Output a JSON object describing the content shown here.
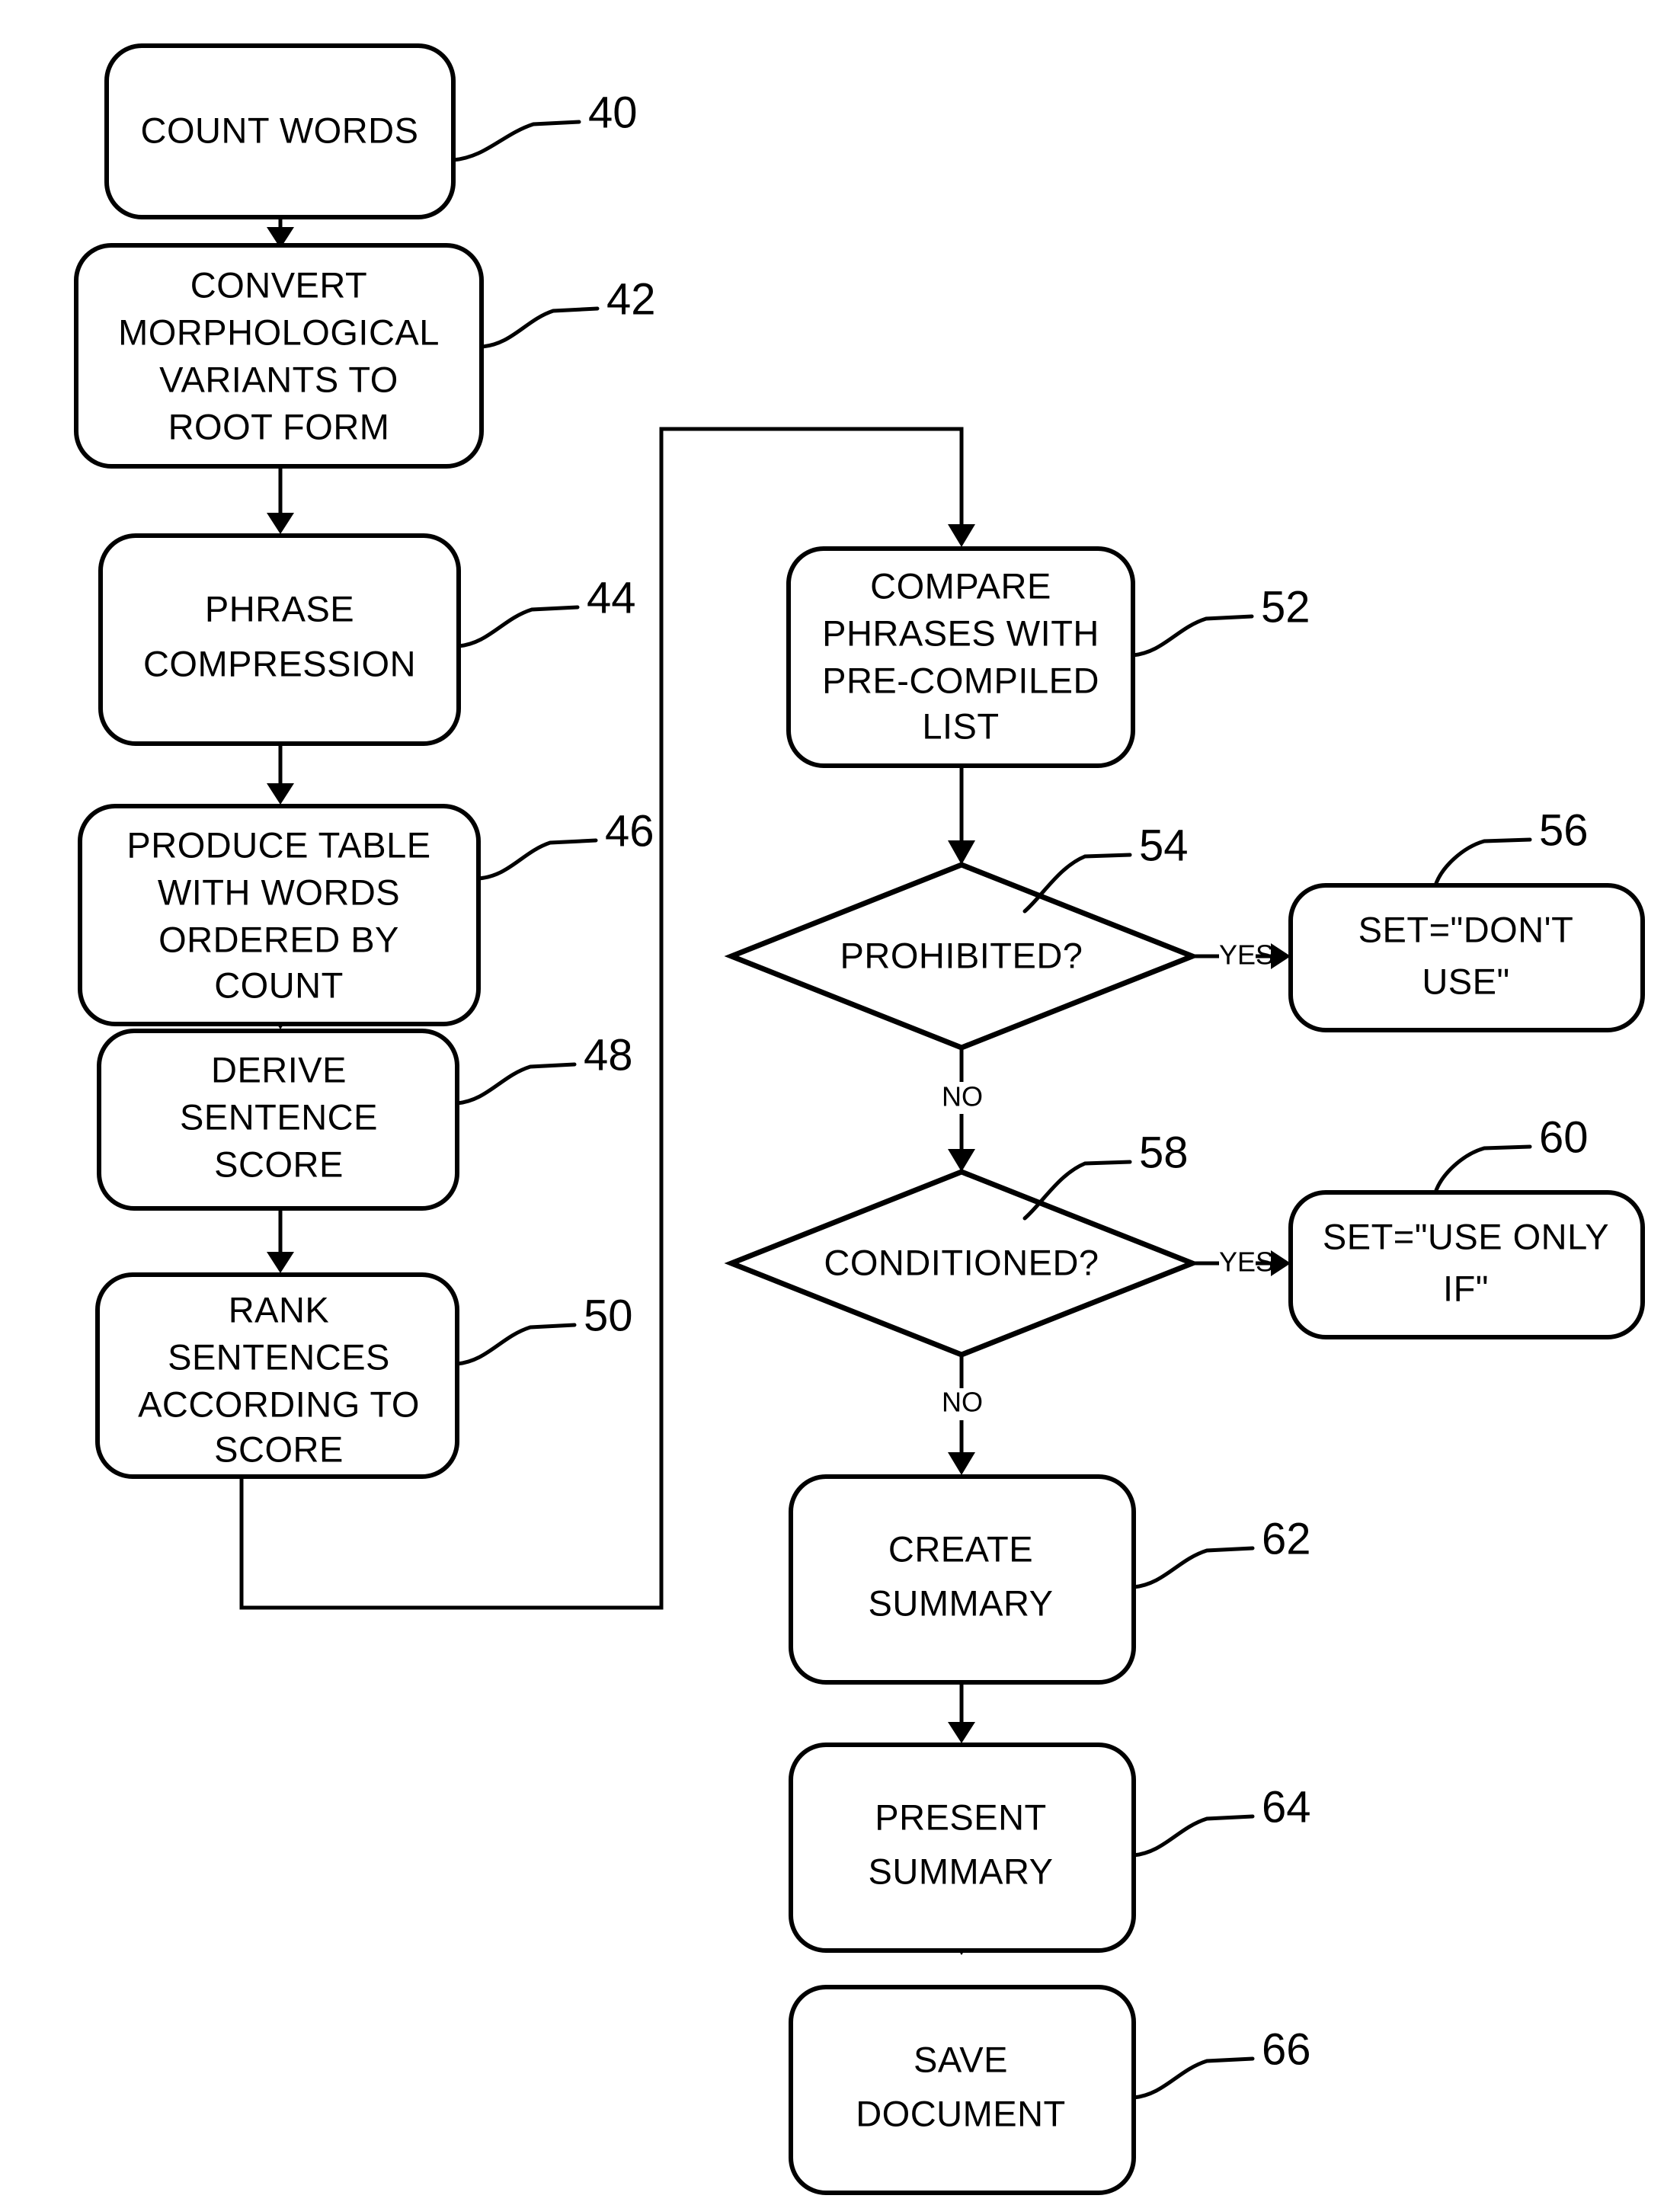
{
  "figure": {
    "type": "patent-flowchart",
    "background_color": "#ffffff",
    "line_color": "#000000"
  },
  "nodes": [
    {
      "id": "n40",
      "shape": "rounded-rect",
      "ref": "40",
      "lines": [
        "COUNT WORDS"
      ]
    },
    {
      "id": "n42",
      "shape": "rounded-rect",
      "ref": "42",
      "lines": [
        "CONVERT",
        "MORPHOLOGICAL",
        "VARIANTS TO",
        "ROOT FORM"
      ]
    },
    {
      "id": "n44",
      "shape": "rounded-rect",
      "ref": "44",
      "lines": [
        "PHRASE",
        "COMPRESSION"
      ]
    },
    {
      "id": "n46",
      "shape": "rounded-rect",
      "ref": "46",
      "lines": [
        "PRODUCE TABLE",
        "WITH WORDS",
        "ORDERED BY",
        "COUNT"
      ]
    },
    {
      "id": "n48",
      "shape": "rounded-rect",
      "ref": "48",
      "lines": [
        "DERIVE",
        "SENTENCE",
        "SCORE"
      ]
    },
    {
      "id": "n50",
      "shape": "rounded-rect",
      "ref": "50",
      "lines": [
        "RANK",
        "SENTENCES",
        "ACCORDING TO",
        "SCORE"
      ]
    },
    {
      "id": "n52",
      "shape": "rounded-rect",
      "ref": "52",
      "lines": [
        "COMPARE",
        "PHRASES WITH",
        "PRE-COMPILED",
        "LIST"
      ]
    },
    {
      "id": "n54",
      "shape": "diamond",
      "ref": "54",
      "lines": [
        "PROHIBITED?"
      ]
    },
    {
      "id": "n56",
      "shape": "rounded-rect",
      "ref": "56",
      "lines": [
        "SET=\"DON'T",
        "USE\""
      ]
    },
    {
      "id": "n58",
      "shape": "diamond",
      "ref": "58",
      "lines": [
        "CONDITIONED?"
      ]
    },
    {
      "id": "n60",
      "shape": "rounded-rect",
      "ref": "60",
      "lines": [
        "SET=\"USE ONLY",
        "IF\""
      ]
    },
    {
      "id": "n62",
      "shape": "rounded-rect",
      "ref": "62",
      "lines": [
        "CREATE",
        "SUMMARY"
      ]
    },
    {
      "id": "n64",
      "shape": "rounded-rect",
      "ref": "64",
      "lines": [
        "PRESENT",
        "SUMMARY"
      ]
    },
    {
      "id": "n66",
      "shape": "rounded-rect",
      "ref": "66",
      "lines": [
        "SAVE",
        "DOCUMENT"
      ]
    }
  ],
  "branch_labels": {
    "prohibited_yes": "YES",
    "prohibited_no": "NO",
    "conditioned_yes": "YES",
    "conditioned_no": "NO"
  },
  "edges": [
    {
      "from": "n40",
      "to": "n42",
      "label": ""
    },
    {
      "from": "n42",
      "to": "n44",
      "label": ""
    },
    {
      "from": "n44",
      "to": "n46",
      "label": ""
    },
    {
      "from": "n46",
      "to": "n48",
      "label": ""
    },
    {
      "from": "n48",
      "to": "n50",
      "label": ""
    },
    {
      "from": "n50",
      "to": "n52",
      "label": "",
      "routing": "feedback-loop-left"
    },
    {
      "from": "n52",
      "to": "n54",
      "label": ""
    },
    {
      "from": "n54",
      "to": "n56",
      "label": "YES"
    },
    {
      "from": "n54",
      "to": "n58",
      "label": "NO"
    },
    {
      "from": "n58",
      "to": "n60",
      "label": "YES"
    },
    {
      "from": "n58",
      "to": "n62",
      "label": "NO"
    },
    {
      "from": "n62",
      "to": "n64",
      "label": ""
    },
    {
      "from": "n64",
      "to": "n66",
      "label": ""
    }
  ]
}
